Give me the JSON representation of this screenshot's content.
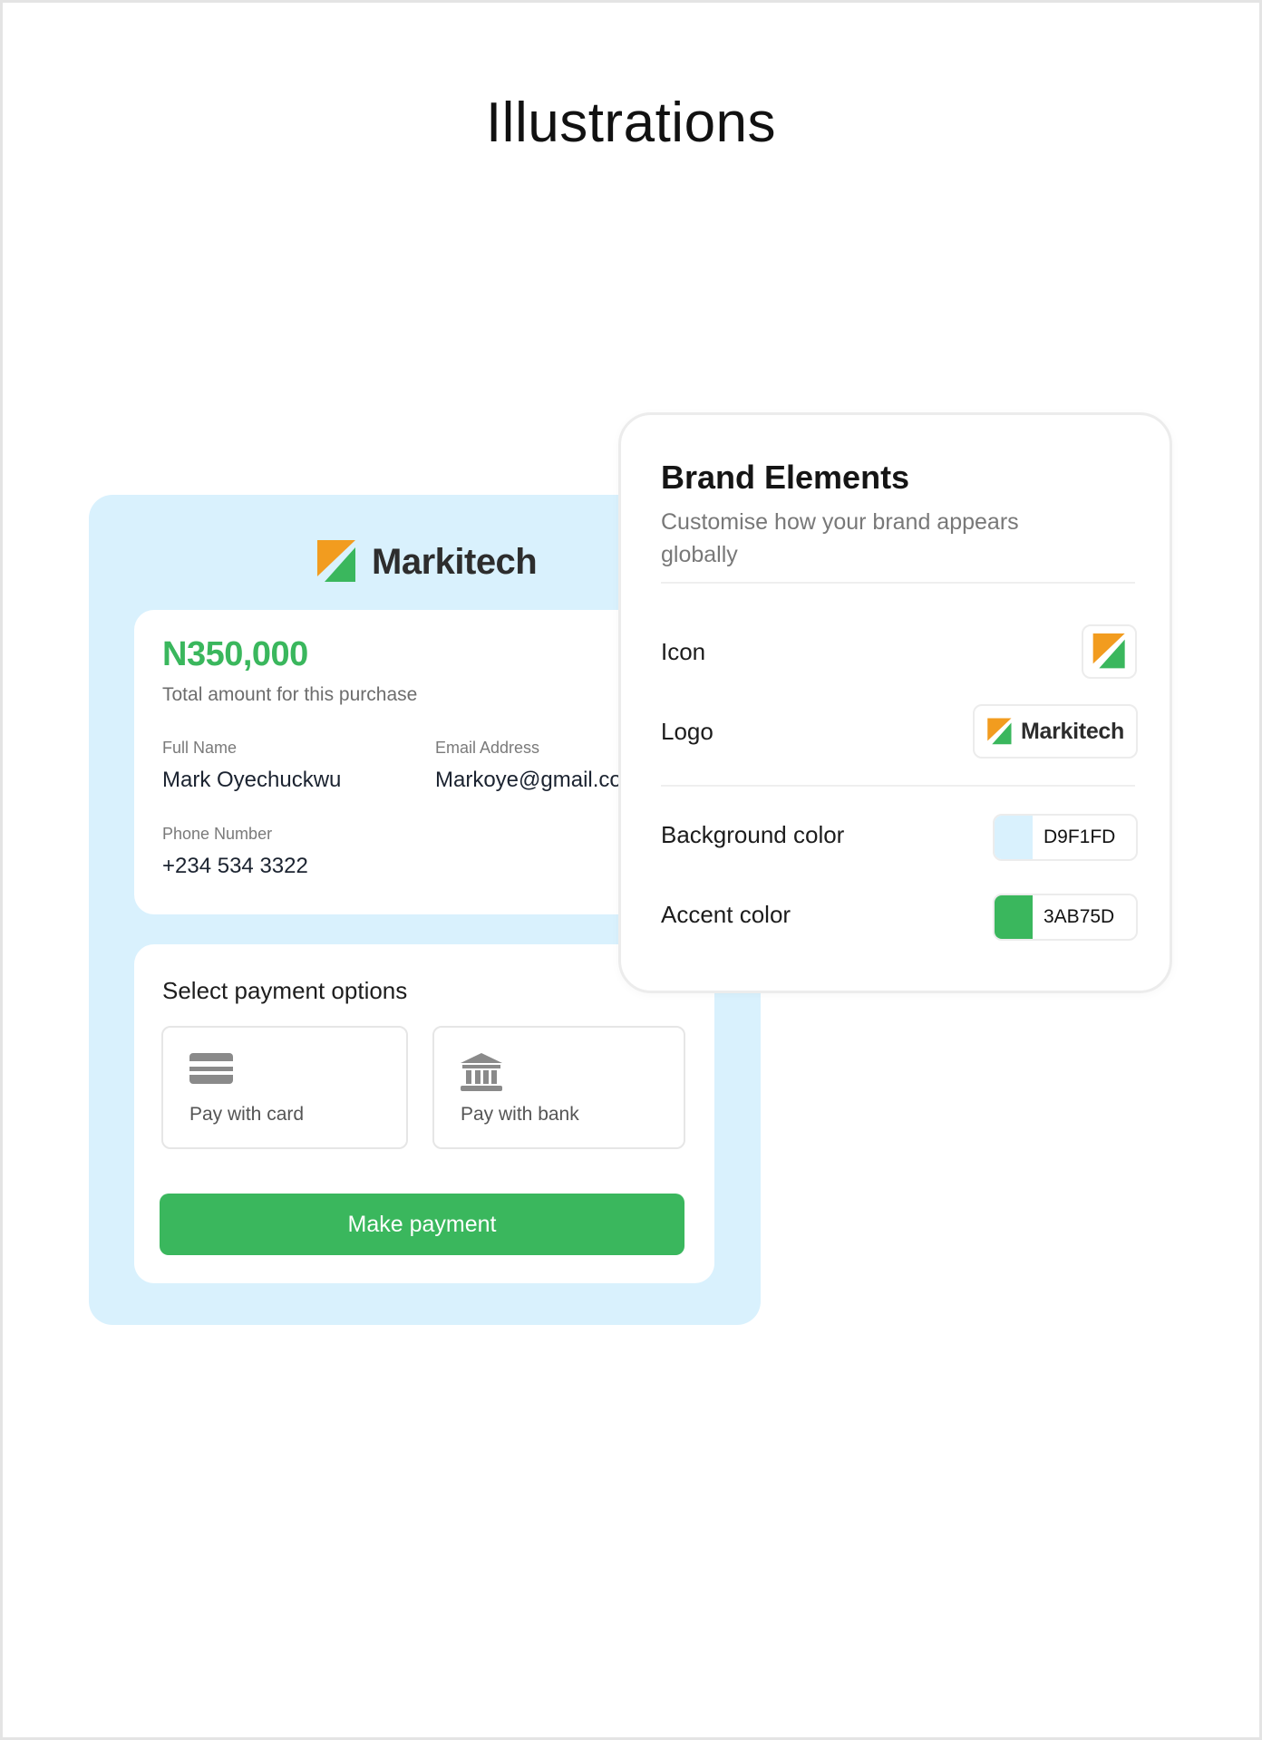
{
  "page": {
    "title": "Illustrations"
  },
  "colors": {
    "accent": "#3AB75D",
    "background": "#D9F1FD",
    "logo_orange": "#F29C1F"
  },
  "checkout": {
    "brand_name": "Markitech",
    "amount": "N350,000",
    "amount_caption": "Total amount for this purchase",
    "fields": {
      "full_name": {
        "label": "Full Name",
        "value": "Mark Oyechuckwu"
      },
      "email": {
        "label": "Email Address",
        "value": "Markoye@gmail.com"
      },
      "phone": {
        "label": "Phone Number",
        "value": "+234 534 3322"
      }
    },
    "payment": {
      "title": "Select payment options",
      "options": [
        {
          "label": "Pay with card",
          "icon": "credit-card-icon"
        },
        {
          "label": "Pay with bank",
          "icon": "bank-icon"
        }
      ],
      "button_label": "Make payment"
    }
  },
  "brand_elements": {
    "title": "Brand Elements",
    "subtitle": "Customise how your brand appears globally",
    "icon_label": "Icon",
    "logo_label": "Logo",
    "logo_text": "Markitech",
    "background_color": {
      "label": "Background color",
      "hex": "D9F1FD",
      "swatch": "#D9F1FD"
    },
    "accent_color": {
      "label": "Accent color",
      "hex": "3AB75D",
      "swatch": "#3AB75D"
    }
  }
}
